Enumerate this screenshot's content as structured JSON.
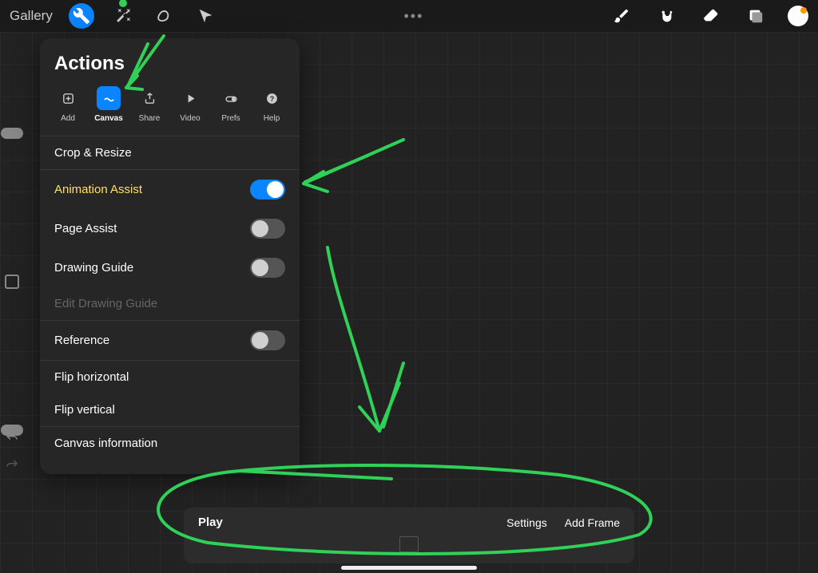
{
  "topBar": {
    "gallery": "Gallery",
    "centerDots": "•••"
  },
  "actionsPanel": {
    "title": "Actions",
    "tabs": [
      {
        "label": "Add",
        "active": false
      },
      {
        "label": "Canvas",
        "active": true
      },
      {
        "label": "Share",
        "active": false
      },
      {
        "label": "Video",
        "active": false
      },
      {
        "label": "Prefs",
        "active": false
      },
      {
        "label": "Help",
        "active": false
      }
    ],
    "sections": [
      [
        {
          "label": "Crop & Resize",
          "type": "link"
        }
      ],
      [
        {
          "label": "Animation Assist",
          "type": "toggle",
          "on": true,
          "highlighted": true
        },
        {
          "label": "Page Assist",
          "type": "toggle",
          "on": false
        },
        {
          "label": "Drawing Guide",
          "type": "toggle",
          "on": false
        },
        {
          "label": "Edit Drawing Guide",
          "type": "link",
          "disabled": true
        }
      ],
      [
        {
          "label": "Reference",
          "type": "toggle",
          "on": false
        }
      ],
      [
        {
          "label": "Flip horizontal",
          "type": "link"
        },
        {
          "label": "Flip vertical",
          "type": "link"
        }
      ],
      [
        {
          "label": "Canvas information",
          "type": "link"
        }
      ]
    ]
  },
  "timeline": {
    "play": "Play",
    "settings": "Settings",
    "addFrame": "Add Frame"
  }
}
